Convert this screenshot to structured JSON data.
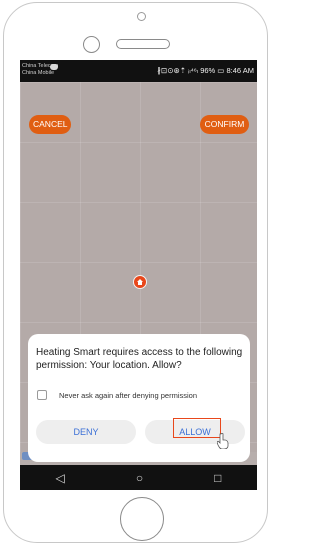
{
  "status_bar": {
    "carrier_1": "China Telecom",
    "carrier_2": "China Mobile",
    "icons": "∦⊡⊙⊛⇡ ᵢₗ⁴⁶ₗ 96% ▭ 8:46 AM"
  },
  "map": {
    "cancel_label": "CANCEL",
    "confirm_label": "CONFIRM"
  },
  "dialog": {
    "message": "Heating Smart requires access to the following permission: Your location. Allow?",
    "checkbox_label": "Never ask again after denying permission",
    "deny_label": "DENY",
    "allow_label": "ALLOW"
  },
  "nav": {
    "back_icon": "◁",
    "home_icon": "○",
    "recents_icon": "□"
  },
  "colors": {
    "accent": "#e05e12",
    "link_blue": "#3a6fd6",
    "highlight": "#e8471b"
  }
}
